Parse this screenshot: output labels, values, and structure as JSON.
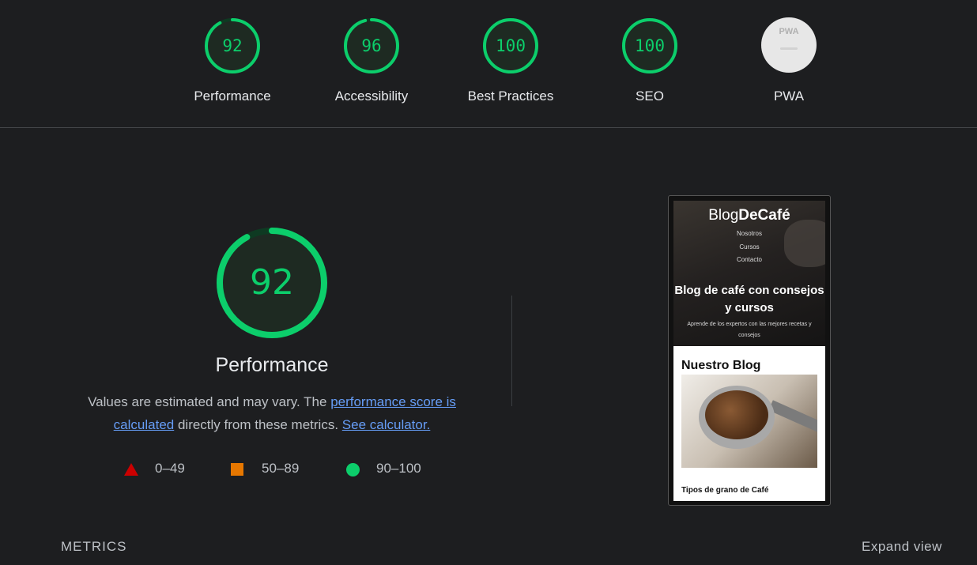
{
  "scores": [
    {
      "label": "Performance",
      "value": "92",
      "fraction": 0.92
    },
    {
      "label": "Accessibility",
      "value": "96",
      "fraction": 0.96
    },
    {
      "label": "Best Practices",
      "value": "100",
      "fraction": 1.0
    },
    {
      "label": "SEO",
      "value": "100",
      "fraction": 1.0
    }
  ],
  "pwa": {
    "label": "PWA",
    "badge_text": "PWA"
  },
  "main": {
    "score": "92",
    "score_fraction": 0.92,
    "title": "Performance",
    "desc_prefix": "Values are estimated and may vary. The ",
    "desc_link1": "performance score is calculated",
    "desc_middle": " directly from these metrics. ",
    "desc_link2": "See calculator."
  },
  "legend": {
    "fail": "0–49",
    "average": "50–89",
    "pass": "90–100"
  },
  "screenshot": {
    "brand_regular": "Blog",
    "brand_bold": "DeCafé",
    "nav": [
      "Nosotros",
      "Cursos",
      "Contacto"
    ],
    "hero_title": "Blog de café con consejos y cursos",
    "hero_subtitle": "Aprende de los expertos con las mejores recetas y consejos",
    "section_title": "Nuestro Blog",
    "card_title": "Tipos de grano de Café"
  },
  "footer": {
    "metrics_label": "METRICS",
    "expand_label": "Expand view"
  },
  "colors": {
    "pass": "#0cce6b",
    "average": "#e67700",
    "fail": "#cc0000",
    "link": "#669df6",
    "background": "#1d1e20"
  }
}
